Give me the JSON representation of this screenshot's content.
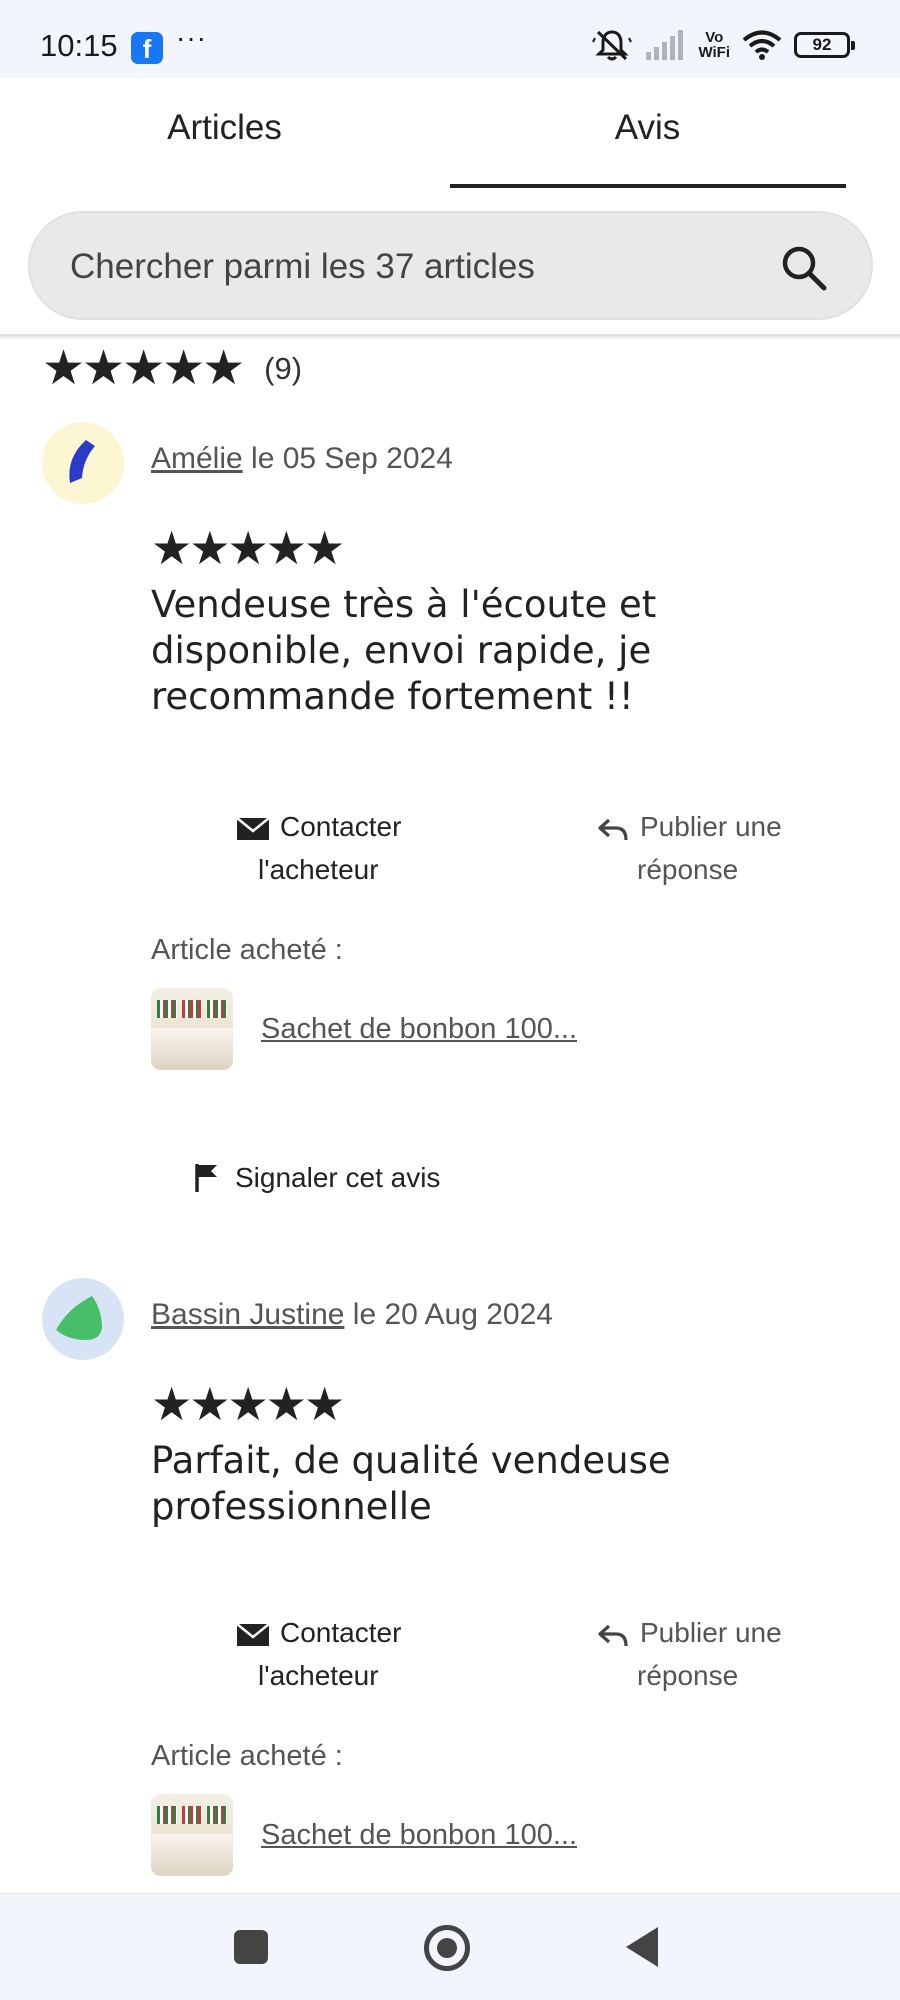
{
  "status_bar": {
    "time": "10:15",
    "app_icon": "facebook-icon",
    "more": "···",
    "vowifi_top": "Vo",
    "vowifi_bottom": "WiFi",
    "battery": "92"
  },
  "tabs": [
    {
      "label": "Articles",
      "selected": false
    },
    {
      "label": "Avis",
      "selected": true
    }
  ],
  "search": {
    "placeholder": "Chercher parmi les 37 articles"
  },
  "rating_summary": {
    "stars": "★★★★★",
    "rating": 5,
    "count": "(9)"
  },
  "reviews": [
    {
      "author": "Amélie",
      "date_text": " le 05 Sep 2024",
      "stars": "★★★★★",
      "rating": 5,
      "text": "Vendeuse très à l'écoute et disponible, envoi rapide, je recommande fortement !!",
      "contact_line1": "Contacter",
      "contact_line2": "l'acheteur",
      "reply_line1": "Publier une",
      "reply_line2": "réponse",
      "bought_label": "Article acheté :",
      "bought_item": "Sachet de bonbon 100...",
      "report": "Signaler cet avis",
      "avatar_bg": "#fdf6d3",
      "avatar_fg": "#2a3cc7"
    },
    {
      "author": "Bassin Justine",
      "date_text": " le 20 Aug 2024",
      "stars": "★★★★★",
      "rating": 5,
      "text": "Parfait, de qualité vendeuse professionnelle",
      "contact_line1": "Contacter",
      "contact_line2": "l'acheteur",
      "reply_line1": "Publier une",
      "reply_line2": "réponse",
      "bought_label": "Article acheté :",
      "bought_item": "Sachet de bonbon 100...",
      "avatar_bg": "#d6e4f5",
      "avatar_fg": "#47bf68"
    }
  ],
  "nav_bar": {
    "icons": [
      "recent-apps-icon",
      "home-icon",
      "back-icon"
    ]
  }
}
